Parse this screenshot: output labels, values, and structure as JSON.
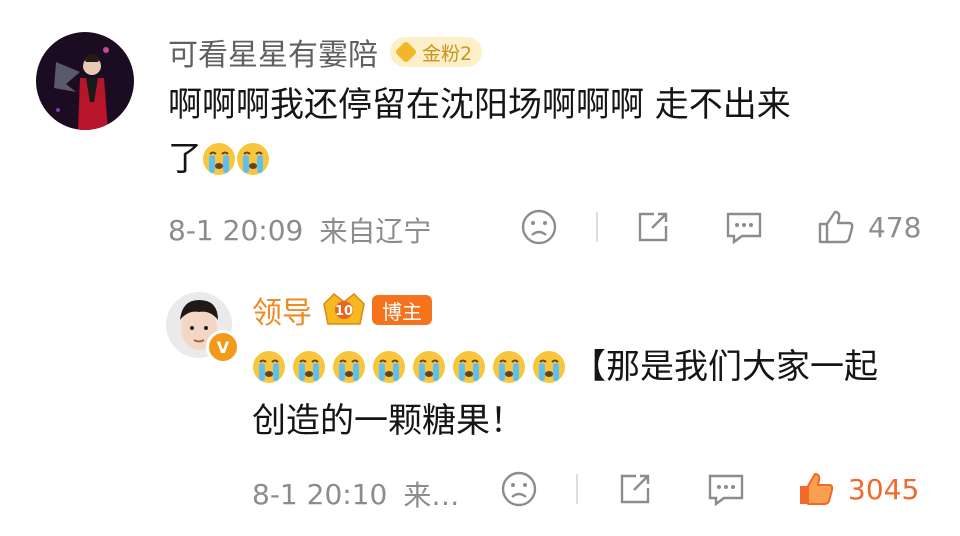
{
  "comment": {
    "username": "可看星星有霎陪",
    "badge": "金粉2",
    "text_line1": "啊啊啊我还停留在沈阳场啊啊啊 走不出来",
    "text_line2": "了",
    "emojis_after_line2": [
      "crying-emoji",
      "crying-emoji"
    ],
    "time": "8-1 20:09",
    "source": "来自辽宁",
    "like_count": "478"
  },
  "reply": {
    "username": "领导",
    "vip_level": "10",
    "role_badge": "博主",
    "emojis_leading": [
      "crying-emoji",
      "crying-emoji",
      "crying-emoji",
      "crying-emoji",
      "crying-emoji",
      "crying-emoji",
      "crying-emoji",
      "crying-emoji"
    ],
    "text_line1": "【那是我们大家一起",
    "text_line2": "创造的一颗糖果！",
    "time": "8-1 20:10",
    "source": "来…",
    "like_count": "3045"
  },
  "colors": {
    "username_gray": "#606060",
    "author_orange": "#ee8a1f",
    "badge_orange": "#f6731e",
    "liked_orange": "#f3682b",
    "meta_gray": "#8c8c8c"
  }
}
